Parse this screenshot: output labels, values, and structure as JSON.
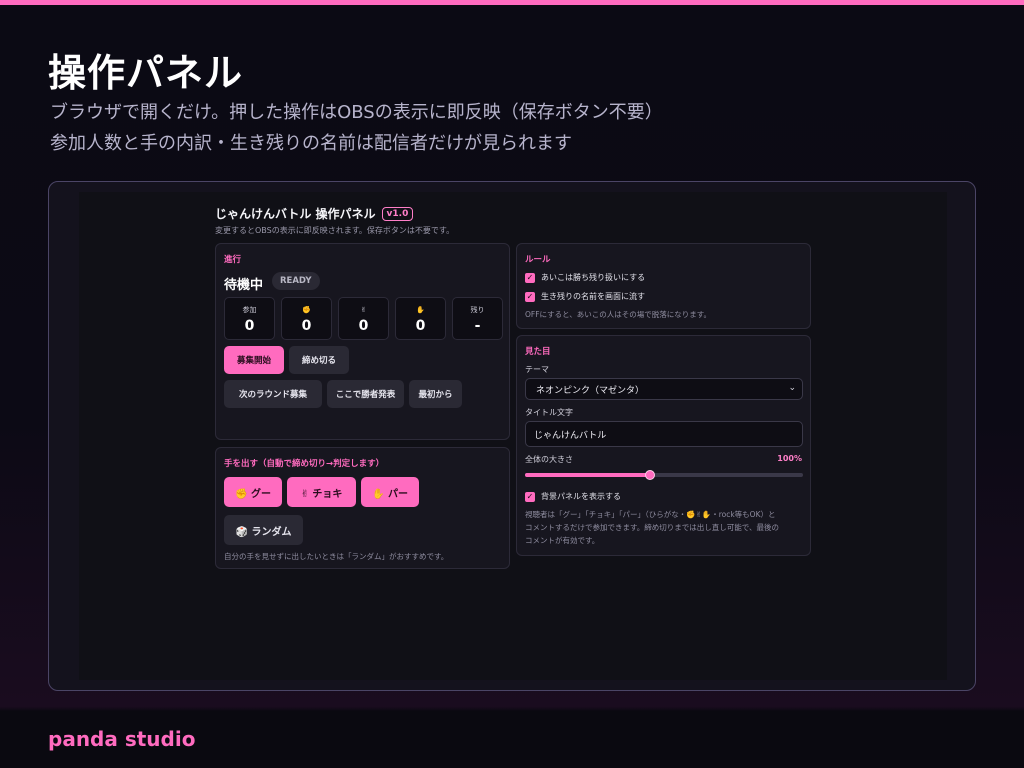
{
  "slide": {
    "title": "操作パネル",
    "subtitle_line1": "ブラウザで開くだけ。押した操作はOBSの表示に即反映（保存ボタン不要）",
    "subtitle_line2": "参加人数と手の内訳・生き残りの名前は配信者だけが見られます",
    "brand": "panda studio"
  },
  "app": {
    "title": "じゃんけんバトル 操作パネル",
    "version": "v1.0",
    "description": "変更するとOBSの表示に即反映されます。保存ボタンは不要です。"
  },
  "progress": {
    "heading": "進行",
    "state": "待機中",
    "state_badge": "READY",
    "stats": [
      {
        "label": "参加",
        "value": "0"
      },
      {
        "label": "✊",
        "value": "0"
      },
      {
        "label": "✌",
        "value": "0"
      },
      {
        "label": "✋",
        "value": "0"
      },
      {
        "label": "残り",
        "value": "-"
      }
    ],
    "buttons": {
      "start_recruit": "募集開始",
      "close_recruit": "締め切る",
      "next_round": "次のラウンド募集",
      "announce_winner": "ここで勝者発表",
      "restart": "最初から"
    }
  },
  "hand": {
    "heading": "手を出す（自動で締め切り→判定します）",
    "rock": "✊ グー",
    "scissors": "✌ チョキ",
    "paper": "✋ パー",
    "random": "🎲 ランダム",
    "note": "自分の手を見せずに出したいときは「ランダム」がおすすめです。"
  },
  "rules": {
    "heading": "ルール",
    "option1": "あいこは勝ち残り扱いにする",
    "option1_checked": true,
    "option2": "生き残りの名前を画面に流す",
    "option2_checked": true,
    "note": "OFFにすると、あいこの人はその場で脱落になります。"
  },
  "appearance": {
    "heading": "見た目",
    "theme_label": "テーマ",
    "theme_value": "ネオンピンク（マゼンタ）",
    "title_label": "タイトル文字",
    "title_value": "じゃんけんバトル",
    "size_label": "全体の大きさ",
    "size_value": "100%",
    "size_fraction": 0.45,
    "bg_panel_label": "背景パネルを表示する",
    "bg_panel_checked": true,
    "note_line1": "視聴者は「グー」「チョキ」「パー」（ひらがな・✊✌✋・rock等もOK）と",
    "note_line2": "コメントするだけで参加できます。締め切りまでは出し直し可能で、最後の",
    "note_line3": "コメントが有効です。"
  },
  "colors": {
    "accent": "#ff6bbf",
    "background": "#0b0a14",
    "card": "#17161f"
  }
}
